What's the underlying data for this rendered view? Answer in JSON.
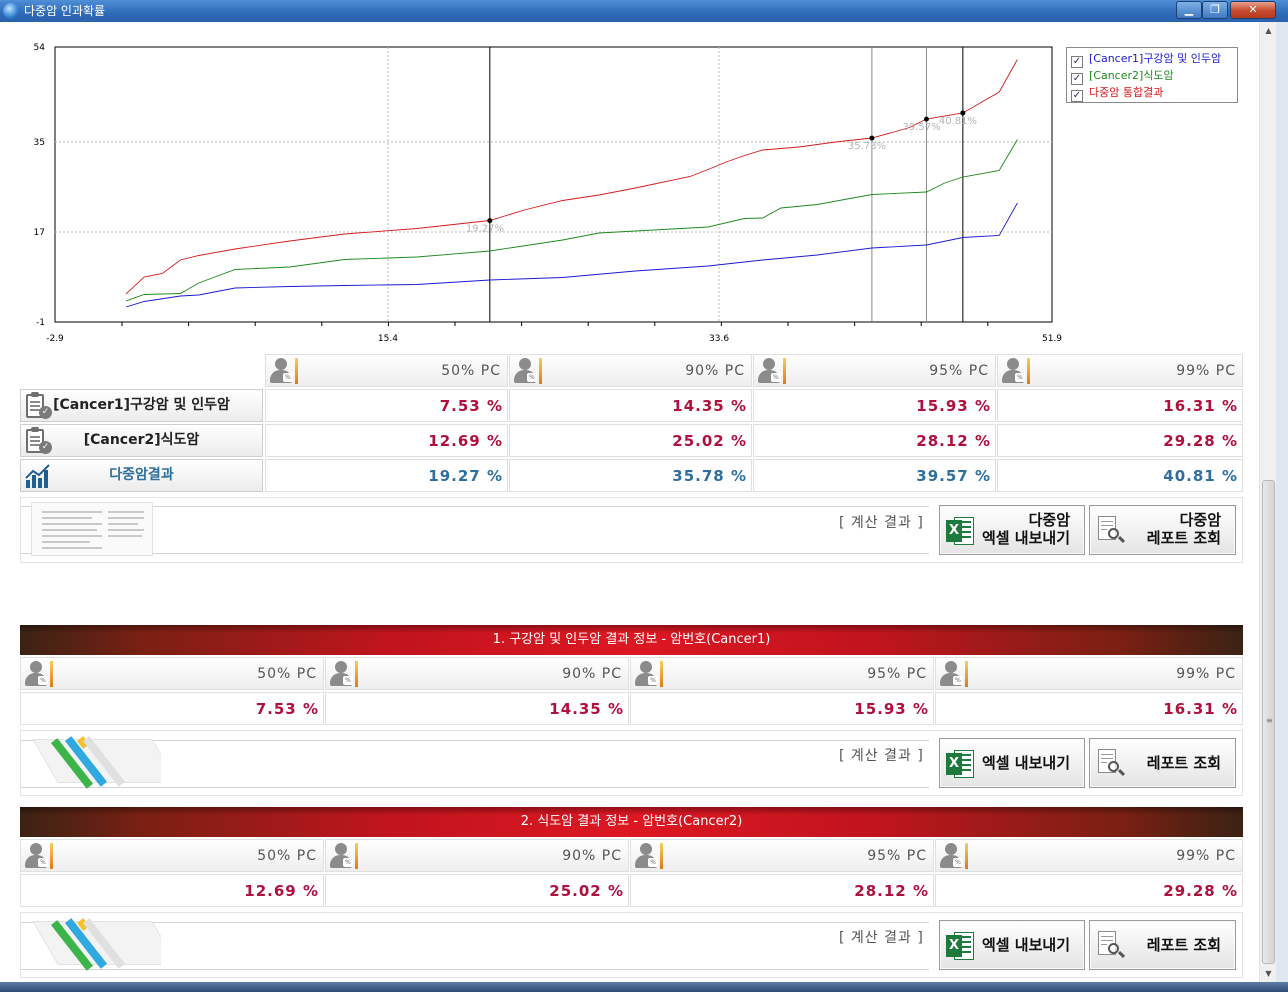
{
  "window": {
    "title": "다중암 인과확률",
    "min_symbol": "▁",
    "max_symbol": "❐",
    "close_symbol": "✕"
  },
  "chart_data": {
    "type": "line",
    "xlim": [
      -2.9,
      51.9
    ],
    "ylim": [
      -1,
      54
    ],
    "x_ticks": [
      "-2.9",
      "15.4",
      "33.6",
      "51.9"
    ],
    "y_ticks": [
      "54",
      "35",
      "17",
      "-1"
    ],
    "grid": true,
    "legend_placement": "top-right",
    "series": [
      {
        "name": "[Cancer1]구강암 및 인두암",
        "color": "#1a1ad0",
        "x": [
          1,
          2,
          4,
          5,
          7,
          10,
          13,
          17,
          21,
          25,
          29,
          33,
          36,
          39,
          42,
          45,
          47,
          49,
          50
        ],
        "y": [
          2.0,
          3.1,
          4.2,
          4.4,
          5.8,
          6.1,
          6.3,
          6.5,
          7.4,
          7.9,
          9.2,
          10.2,
          11.4,
          12.4,
          13.8,
          14.4,
          15.9,
          16.3,
          22.8
        ]
      },
      {
        "name": "[Cancer2]식도암",
        "color": "#1f8a1f",
        "x": [
          1,
          2,
          4,
          5,
          7,
          10,
          13,
          17,
          21,
          25,
          27,
          29,
          33,
          35,
          36,
          37,
          39,
          42,
          45,
          46,
          47,
          49,
          50
        ],
        "y": [
          3.2,
          4.5,
          4.7,
          6.8,
          9.5,
          10.0,
          11.5,
          12.0,
          13.2,
          15.4,
          16.8,
          17.2,
          18.0,
          19.7,
          19.8,
          21.8,
          22.5,
          24.5,
          25.0,
          26.8,
          28.0,
          29.3,
          35.5
        ]
      },
      {
        "name": "다중암 통합결과",
        "color": "#d41a1a",
        "x": [
          1,
          2,
          3,
          4,
          5,
          7,
          10,
          13,
          17,
          21,
          23,
          25,
          27,
          29,
          32,
          33,
          34,
          35,
          36,
          38,
          40,
          42,
          44,
          45,
          47,
          48,
          49,
          50
        ],
        "y": [
          4.6,
          8.0,
          8.7,
          11.4,
          12.3,
          13.6,
          15.2,
          16.6,
          17.7,
          19.3,
          21.5,
          23.3,
          24.4,
          25.8,
          28.1,
          29.5,
          31.0,
          32.3,
          33.4,
          34.0,
          35.0,
          35.8,
          37.8,
          39.6,
          40.8,
          42.9,
          45.0,
          51.5
        ]
      }
    ],
    "markers": [
      {
        "x": 21,
        "y": 19.27,
        "label": "19.27%"
      },
      {
        "x": 42,
        "y": 35.78,
        "label": "35.78%"
      },
      {
        "x": 45,
        "y": 39.57,
        "label": "39.57%"
      },
      {
        "x": 47,
        "y": 40.81,
        "label": "40.81%"
      }
    ]
  },
  "legend": {
    "items": [
      {
        "label": "[Cancer1]구강암 및 인두암",
        "checked": "✓",
        "color": "#1a1ad0"
      },
      {
        "label": "[Cancer2]식도암",
        "checked": "✓",
        "color": "#1f8a1f"
      },
      {
        "label": "다중암 통합결과",
        "checked": "✓",
        "color": "#d41a1a"
      }
    ]
  },
  "summary": {
    "headers": [
      "50% PC",
      "90% PC",
      "95% PC",
      "99% PC"
    ],
    "rows": [
      {
        "label": "[Cancer1]구강암 및 인두암",
        "values": [
          "7.53 %",
          "14.35 %",
          "15.93 %",
          "16.31 %"
        ]
      },
      {
        "label": "[Cancer2]식도암",
        "values": [
          "12.69 %",
          "25.02 %",
          "28.12 %",
          "29.28 %"
        ]
      },
      {
        "label": "다중암결과",
        "values": [
          "19.27 %",
          "35.78 %",
          "39.57 %",
          "40.81 %"
        ]
      }
    ],
    "calc_label": "[ 계산 결과 ]",
    "excel_button": "다중암\n엑셀 내보내기",
    "report_button": "다중암\n레포트 조회"
  },
  "sections": [
    {
      "title": "1. 구강암 및 인두암 결과 정보 - 암번호(Cancer1)",
      "headers": [
        "50% PC",
        "90% PC",
        "95% PC",
        "99% PC"
      ],
      "values": [
        "7.53 %",
        "14.35 %",
        "15.93 %",
        "16.31 %"
      ],
      "calc_label": "[ 계산 결과 ]",
      "excel_button": "엑셀 내보내기",
      "report_button": "레포트 조회"
    },
    {
      "title": "2. 식도암 결과 정보 - 암번호(Cancer2)",
      "headers": [
        "50% PC",
        "90% PC",
        "95% PC",
        "99% PC"
      ],
      "values": [
        "12.69 %",
        "25.02 %",
        "28.12 %",
        "29.28 %"
      ],
      "calc_label": "[ 계산 결과 ]",
      "excel_button": "엑셀 내보내기",
      "report_button": "레포트 조회"
    }
  ],
  "icons": {
    "percent_mark": "%",
    "check_mark": "✓",
    "excel_mark": "X",
    "scroll_up": "▲",
    "scroll_down": "▼",
    "grip": "≡"
  }
}
